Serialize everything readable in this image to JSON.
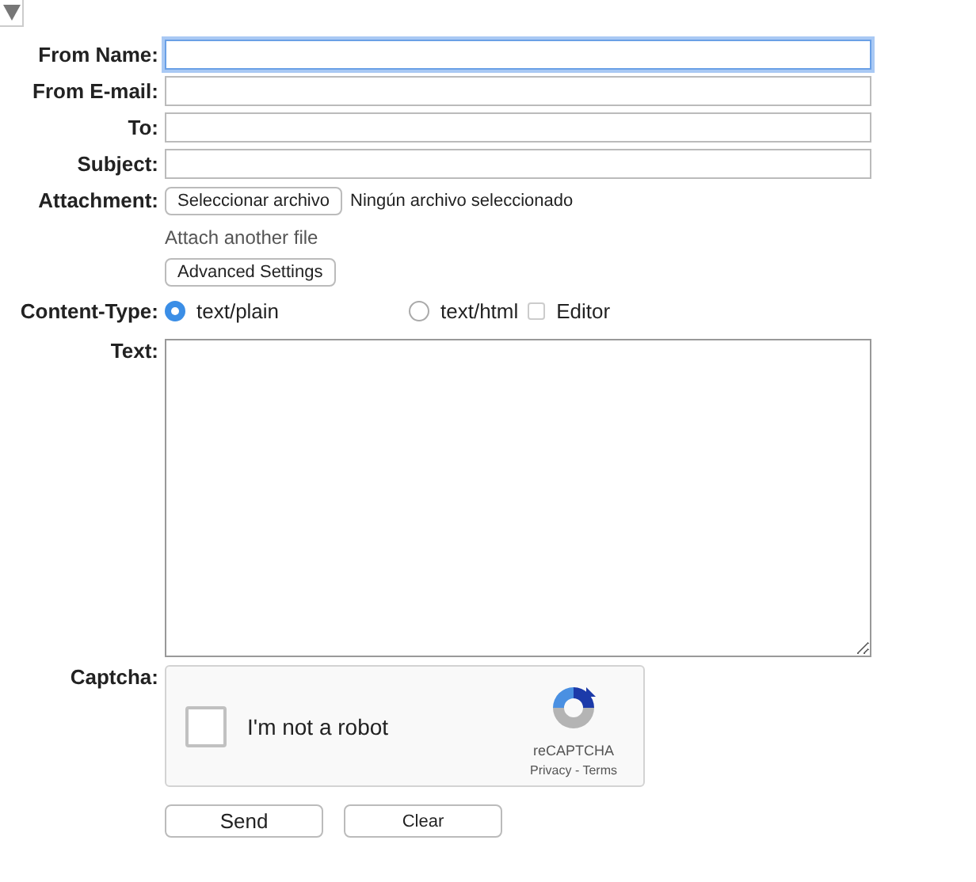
{
  "toggle": {
    "expanded": true
  },
  "fields": [
    {
      "label": "From Name:",
      "focused": true
    },
    {
      "label": "From E-mail:",
      "focused": false
    },
    {
      "label": "To:",
      "focused": false
    },
    {
      "label": "Subject:",
      "focused": false
    }
  ],
  "attachment": {
    "label": "Attachment:",
    "button": "Seleccionar archivo",
    "status": "Ningún archivo seleccionado",
    "another_link": "Attach another file"
  },
  "advanced_button": "Advanced Settings",
  "content_type": {
    "label": "Content-Type:",
    "options": [
      {
        "kind": "radio",
        "label": "text/plain",
        "selected": true
      },
      {
        "kind": "radio",
        "label": "text/html",
        "selected": false
      },
      {
        "kind": "checkbox",
        "label": "Editor",
        "checked": false
      }
    ]
  },
  "text": {
    "label": "Text:"
  },
  "captcha": {
    "label": "Captcha:",
    "checkbox_label": "I'm not a robot",
    "checked": false,
    "brand": "reCAPTCHA",
    "privacy": "Privacy",
    "separator": " - ",
    "terms": "Terms"
  },
  "buttons": [
    "Send",
    "Clear"
  ]
}
